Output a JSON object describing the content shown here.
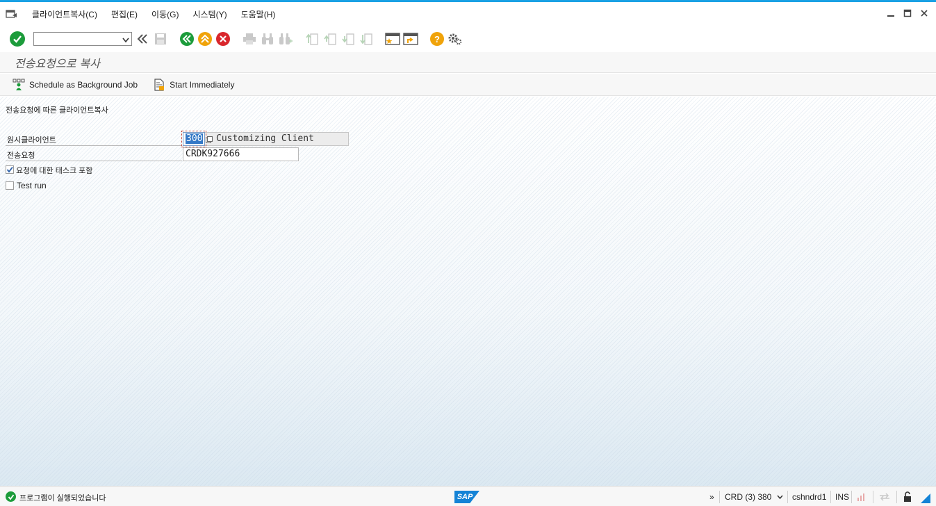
{
  "menubar": {
    "items": [
      {
        "label": "클라이언트복사(C)"
      },
      {
        "label": "편집(E)"
      },
      {
        "label": "이동(G)"
      },
      {
        "label": "시스템(Y)"
      },
      {
        "label": "도움말(H)"
      }
    ]
  },
  "toolbar": {
    "command_field_value": ""
  },
  "page": {
    "title": "전송요청으로 복사"
  },
  "app_toolbar": {
    "schedule_label": "Schedule as Background Job",
    "start_label": "Start Immediately"
  },
  "form": {
    "section_title": "전송요청에 따른 클라이언트복사",
    "source_client_label": "원시클라이언트",
    "source_client_value": "300",
    "source_client_desc": "Customizing Client",
    "transport_request_label": "전송요청",
    "transport_request_value": "CRDK927666",
    "include_tasks_label": "요청에 대한 태스크 포함",
    "include_tasks_checked": true,
    "test_run_label": "Test run",
    "test_run_checked": false
  },
  "statusbar": {
    "message": "프로그램이 실행되었습니다",
    "more": "»",
    "system": "CRD (3) 380",
    "server": "cshndrd1",
    "mode": "INS"
  },
  "colors": {
    "accent": "#1aa1e4",
    "ok_green": "#1c9c3b",
    "back_green": "#1c9c3b",
    "exit_yellow": "#f0a30a",
    "cancel_red": "#d9262c",
    "help_yellow": "#f0a30a",
    "sap_blue": "#1483d6"
  }
}
